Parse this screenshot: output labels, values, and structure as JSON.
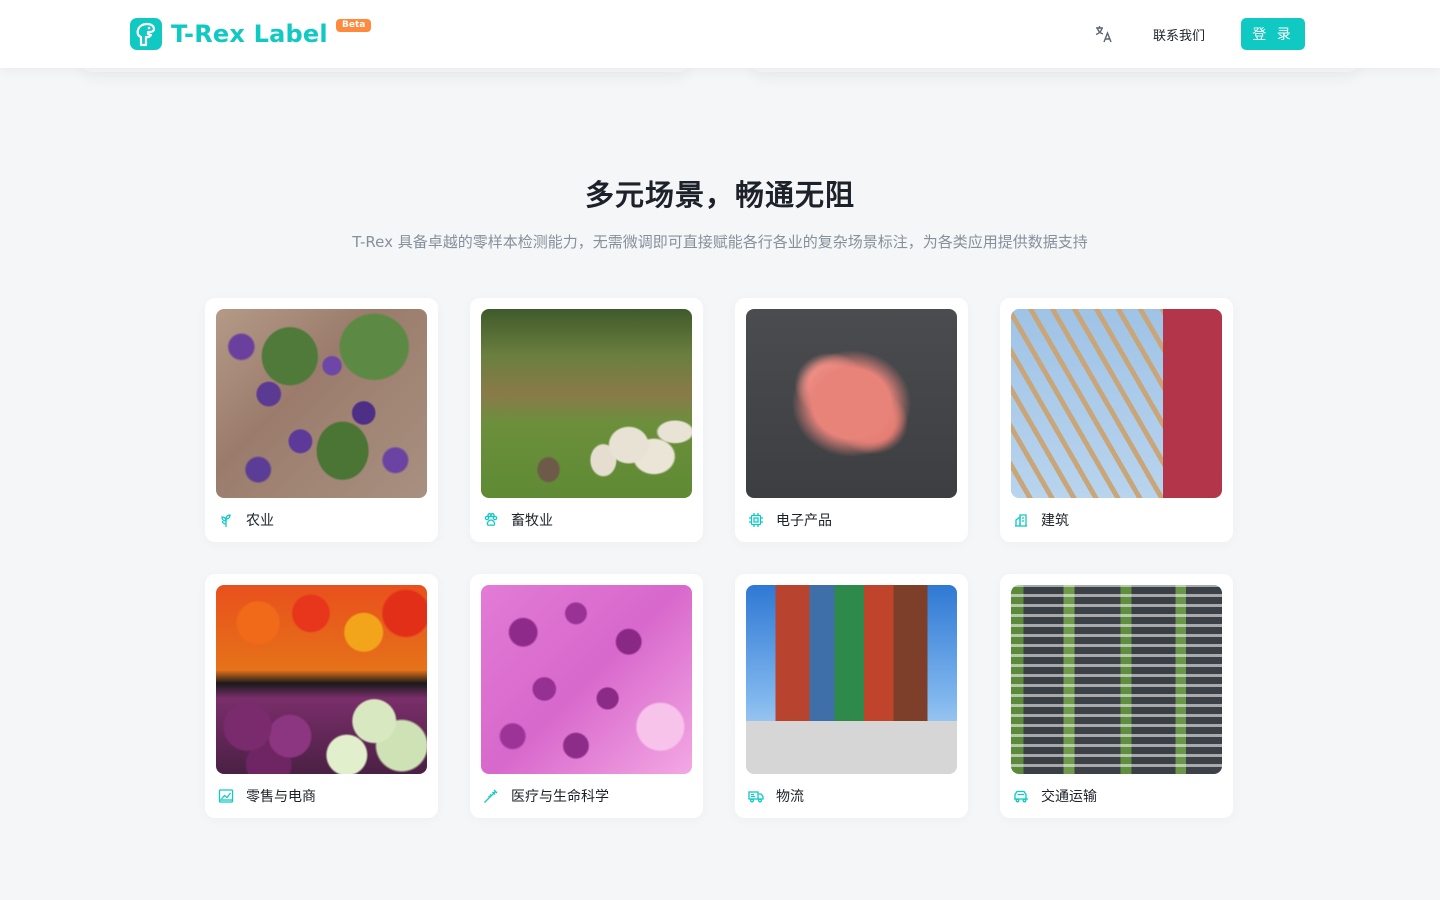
{
  "header": {
    "brand": "T-Rex Label",
    "beta_badge": "Beta",
    "language_icon": "translate-icon",
    "contact_label": "联系我们",
    "login_label": "登 录",
    "accent_color": "#10c9c3"
  },
  "section": {
    "title": "多元场景，畅通无阻",
    "subtitle": "T-Rex 具备卓越的零样本检测能力，无需微调即可直接赋能各行各业的复杂场景标注，为各类应用提供数据支持"
  },
  "scenarios": [
    {
      "label": "农业",
      "icon": "sprout-icon"
    },
    {
      "label": "畜牧业",
      "icon": "paw-icon"
    },
    {
      "label": "电子产品",
      "icon": "chip-icon"
    },
    {
      "label": "建筑",
      "icon": "building-icon"
    },
    {
      "label": "零售与电商",
      "icon": "store-chart-icon"
    },
    {
      "label": "医疗与生命科学",
      "icon": "syringe-icon"
    },
    {
      "label": "物流",
      "icon": "truck-icon"
    },
    {
      "label": "交通运输",
      "icon": "vehicle-icon"
    }
  ]
}
